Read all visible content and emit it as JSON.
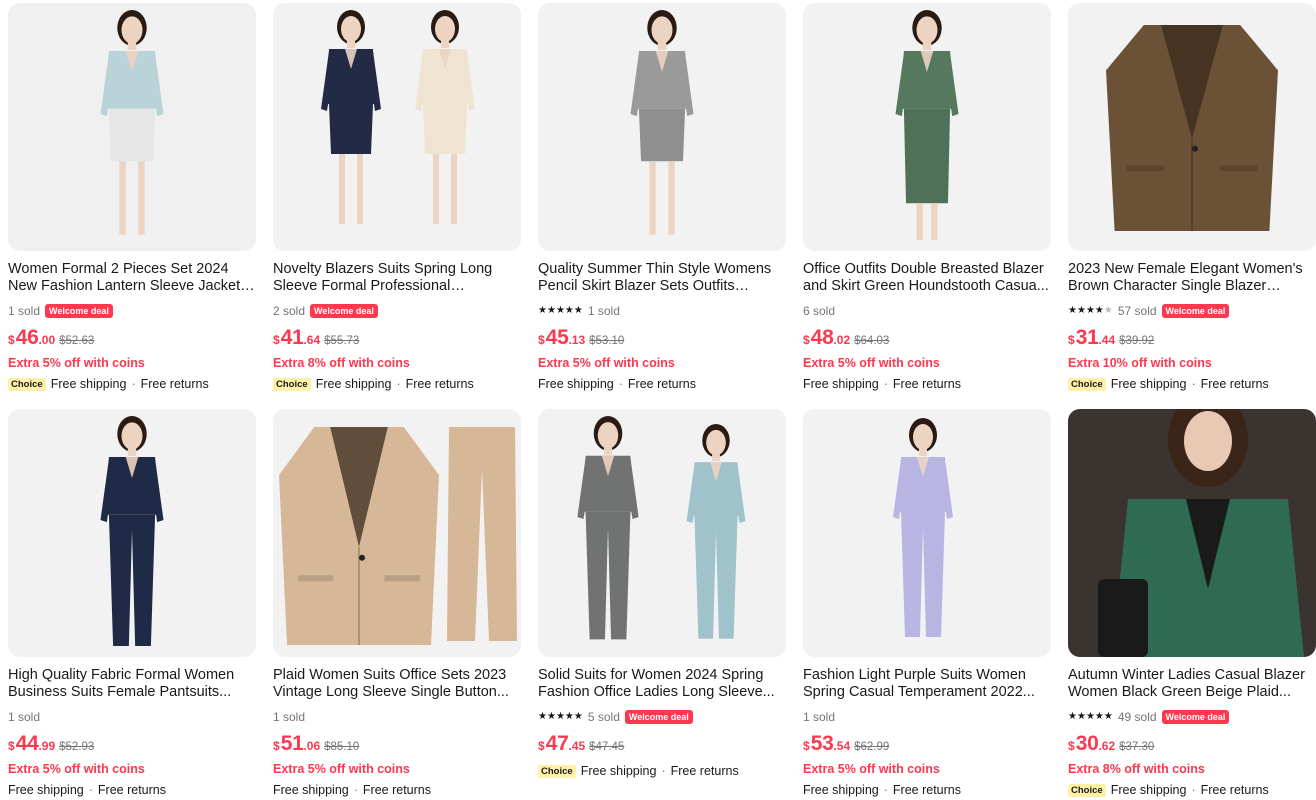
{
  "products": [
    {
      "title": "Women Formal 2 Pieces Set 2024 New Fashion Lantern Sleeve Jacket ...",
      "rating": null,
      "sold": "1 sold",
      "badge": "Welcome deal",
      "currency": "$",
      "price_int": "46",
      "price_dec": ".00",
      "old_price": "$52.63",
      "coins": "Extra 5% off with coins",
      "choice": "Choice",
      "shipping": "Free shipping",
      "returns": "Free returns",
      "image": {
        "bg": "#f0f0f0",
        "outfit": "#b9d3d9",
        "bottom": "#e6e6e6",
        "skin": "#ecd3c2",
        "hair": "#2a1a14",
        "kind": "skirt"
      }
    },
    {
      "title": "Novelty Blazers Suits Spring Long Sleeve Formal Professional Business...",
      "rating": null,
      "sold": "2 sold",
      "badge": "Welcome deal",
      "currency": "$",
      "price_int": "41",
      "price_dec": ".64",
      "old_price": "$55.73",
      "coins": "Extra 8% off with coins",
      "choice": "Choice",
      "shipping": "Free shipping",
      "returns": "Free returns",
      "image": {
        "bg": "#f2f2f2",
        "outfit": "#232a45",
        "bottom": "#232a45",
        "outfit2": "#efe4d2",
        "skin": "#ecd3c2",
        "hair": "#2a1a14",
        "kind": "duo-skirt"
      }
    },
    {
      "title": "Quality Summer Thin Style Womens Pencil Skirt Blazer Sets Outfits Korea...",
      "rating": 5,
      "sold": "1 sold",
      "badge": "",
      "currency": "$",
      "price_int": "45",
      "price_dec": ".13",
      "old_price": "$53.10",
      "coins": "Extra 5% off with coins",
      "choice": "",
      "shipping": "Free shipping",
      "returns": "Free returns",
      "image": {
        "bg": "#f2f2f2",
        "outfit": "#9a9a9a",
        "bottom": "#8f8f8f",
        "skin": "#ecd3c2",
        "hair": "#2a1a14",
        "kind": "skirt"
      }
    },
    {
      "title": "Office Outfits Double Breasted Blazer and Skirt Green Houndstooth Casua...",
      "rating": null,
      "sold": "6 sold",
      "badge": "",
      "currency": "$",
      "price_int": "48",
      "price_dec": ".02",
      "old_price": "$64.03",
      "coins": "Extra 5% off with coins",
      "choice": "",
      "shipping": "Free shipping",
      "returns": "Free returns",
      "image": {
        "bg": "#f2f2f2",
        "outfit": "#55785e",
        "bottom": "#4f7157",
        "skin": "#ecd3c2",
        "hair": "#2a1a14",
        "kind": "longskirt"
      }
    },
    {
      "title": "2023 New Female Elegant Women's Brown Character Single Blazer Sprin...",
      "rating": 4,
      "sold": "57 sold",
      "badge": "Welcome deal",
      "currency": "$",
      "price_int": "31",
      "price_dec": ".44",
      "old_price": "$39.92",
      "coins": "Extra 10% off with coins",
      "choice": "Choice",
      "shipping": "Free shipping",
      "returns": "Free returns",
      "image": {
        "bg": "#f2f2f2",
        "outfit": "#6b5236",
        "kind": "jacket"
      }
    },
    {
      "title": "High Quality Fabric Formal Women Business Suits Female Pantsuits...",
      "rating": null,
      "sold": "1 sold",
      "badge": "",
      "currency": "$",
      "price_int": "44",
      "price_dec": ".99",
      "old_price": "$52.93",
      "coins": "Extra 5% off with coins",
      "choice": "",
      "shipping": "Free shipping",
      "returns": "Free returns",
      "image": {
        "bg": "#f2f2f2",
        "outfit": "#1f2a47",
        "bottom": "#1f2a47",
        "skin": "#ecd3c2",
        "hair": "#2a1a14",
        "kind": "pants"
      }
    },
    {
      "title": "Plaid Women Suits Office Sets 2023 Vintage Long Sleeve Single Button...",
      "rating": null,
      "sold": "1 sold",
      "badge": "",
      "currency": "$",
      "price_int": "51",
      "price_dec": ".06",
      "old_price": "$85.10",
      "coins": "Extra 5% off with coins",
      "choice": "",
      "shipping": "Free shipping",
      "returns": "Free returns",
      "image": {
        "bg": "#f2f2f2",
        "outfit": "#d6b899",
        "kind": "jacket-pants"
      }
    },
    {
      "title": "Solid Suits for Women 2024 Spring Fashion Office Ladies Long Sleeve...",
      "rating": 5,
      "sold": "5 sold",
      "badge": "Welcome deal",
      "currency": "$",
      "price_int": "47",
      "price_dec": ".45",
      "old_price": "$47.45",
      "coins": "",
      "choice": "Choice",
      "shipping": "Free shipping",
      "returns": "Free returns",
      "image": {
        "bg": "#f2f2f2",
        "outfit": "#707372",
        "bottom": "#707372",
        "outfit2": "#9fc2cb",
        "skin": "#ecd3c2",
        "hair": "#2a1a14",
        "kind": "duo-pants"
      }
    },
    {
      "title": "Fashion Light Purple Suits Women Spring Casual Temperament 2022...",
      "rating": null,
      "sold": "1 sold",
      "badge": "",
      "currency": "$",
      "price_int": "53",
      "price_dec": ".54",
      "old_price": "$62.99",
      "coins": "Extra 5% off with coins",
      "choice": "",
      "shipping": "Free shipping",
      "returns": "Free returns",
      "image": {
        "bg": "#f2f2f2",
        "outfit": "#b8b5e3",
        "bottom": "#b8b5e3",
        "skin": "#ecd3c2",
        "hair": "#2a1a14",
        "kind": "pants-small"
      }
    },
    {
      "title": "Autumn Winter Ladies Casual Blazer Women Black Green Beige Plaid...",
      "rating": 4.5,
      "sold": "49 sold",
      "badge": "Welcome deal",
      "currency": "$",
      "price_int": "30",
      "price_dec": ".62",
      "old_price": "$37.30",
      "coins": "Extra 8% off with coins",
      "choice": "Choice",
      "shipping": "Free shipping",
      "returns": "Free returns",
      "image": {
        "bg": "#3b3330",
        "outfit": "#2f6a52",
        "bottom": "#1a1a1a",
        "skin": "#e8c9b4",
        "hair": "#3a2518",
        "kind": "closeup"
      }
    }
  ]
}
